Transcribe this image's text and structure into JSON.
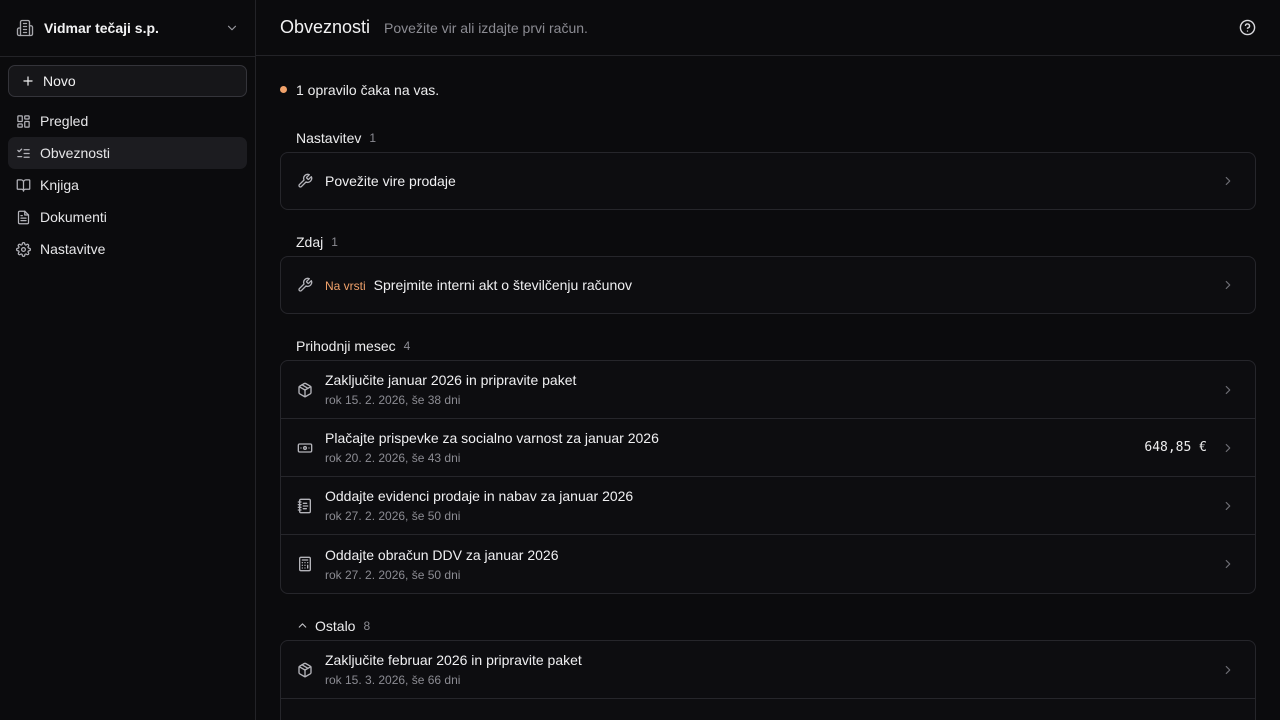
{
  "sidebar": {
    "org_name": "Vidmar tečaji s.p.",
    "new_label": "Novo",
    "items": [
      {
        "label": "Pregled",
        "icon": "grid-icon"
      },
      {
        "label": "Obveznosti",
        "icon": "checklist-icon"
      },
      {
        "label": "Knjiga",
        "icon": "book-icon"
      },
      {
        "label": "Dokumenti",
        "icon": "document-icon"
      },
      {
        "label": "Nastavitve",
        "icon": "gear-icon"
      }
    ],
    "active_item": "Obveznosti"
  },
  "header": {
    "title": "Obveznosti",
    "subtitle": "Povežite vir ali izdajte prvi račun."
  },
  "main": {
    "pending_text": "1 opravilo čaka na vas.",
    "sections": [
      {
        "title": "Nastavitev",
        "count": "1",
        "rows": [
          {
            "title": "Povežite vire prodaje",
            "icon": "wrench-icon"
          }
        ]
      },
      {
        "title": "Zdaj",
        "count": "1",
        "rows": [
          {
            "badge": "Na vrsti",
            "title": "Sprejmite interni akt o številčenju računov",
            "icon": "wrench-icon"
          }
        ]
      },
      {
        "title": "Prihodnji mesec",
        "count": "4",
        "rows": [
          {
            "title": "Zaključite januar 2026 in pripravite paket",
            "subtitle": "rok 15. 2. 2026, še 38 dni",
            "icon": "package-icon"
          },
          {
            "title": "Plačajte prispevke za socialno varnost za januar 2026",
            "subtitle": "rok 20. 2. 2026, še 43 dni",
            "amount": "648,85 €",
            "icon": "banknote-icon"
          },
          {
            "title": "Oddajte evidenci prodaje in nabav za januar 2026",
            "subtitle": "rok 27. 2. 2026, še 50 dni",
            "icon": "notebook-icon"
          },
          {
            "title": "Oddajte obračun DDV za januar 2026",
            "subtitle": "rok 27. 2. 2026, še 50 dni",
            "icon": "calculator-icon"
          }
        ]
      },
      {
        "title": "Ostalo",
        "count": "8",
        "collapsible": true,
        "rows": [
          {
            "title": "Zaključite februar 2026 in pripravite paket",
            "subtitle": "rok 15. 3. 2026, še 66 dni",
            "icon": "package-icon"
          }
        ]
      }
    ]
  },
  "colors": {
    "background": "#0b0b0d",
    "accent": "#f1a26b",
    "border": "#26262b"
  }
}
